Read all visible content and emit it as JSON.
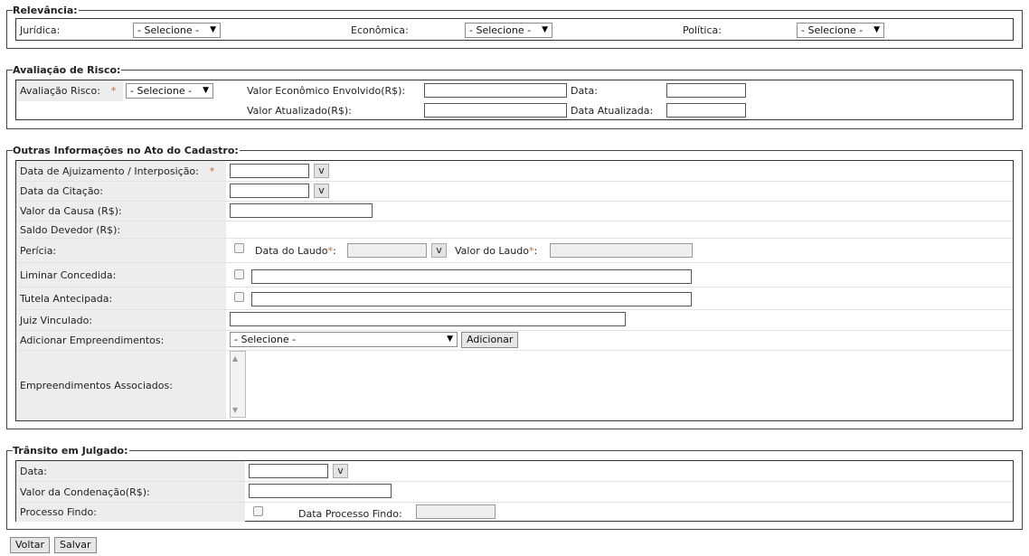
{
  "relevancia": {
    "legend": "Relevância:",
    "juridica_label": "Jurídica:",
    "juridica_value": "- Selecione -",
    "economica_label": "Econômica:",
    "economica_value": "- Selecione -",
    "politica_label": "Política:",
    "politica_value": "- Selecione -"
  },
  "avaliacao": {
    "legend": "Avaliação de Risco:",
    "risco_label": "Avaliação Risco:",
    "risco_value": "- Selecione -",
    "valor_economico_label": "Valor Econômico Envolvido(R$):",
    "data_label": "Data:",
    "valor_atualizado_label": "Valor Atualizado(R$):",
    "data_atualizada_label": "Data Atualizada:"
  },
  "outras": {
    "legend": "Outras Informações no Ato do Cadastro:",
    "ajuizamento_label": "Data de Ajuizamento / Interposição:",
    "citacao_label": "Data da Citação:",
    "valor_causa_label": "Valor da Causa (R$):",
    "saldo_devedor_label": "Saldo Devedor (R$):",
    "pericia_label": "Perícia:",
    "data_laudo_label": "Data do Laudo",
    "valor_laudo_label": "Valor do Laudo",
    "liminar_label": "Liminar Concedida:",
    "tutela_label": "Tutela Antecipada:",
    "juiz_label": "Juiz Vinculado:",
    "adicionar_label": "Adicionar Empreendimentos:",
    "adicionar_value": "- Selecione -",
    "adicionar_button": "Adicionar",
    "associados_label": "Empreendimentos Associados:"
  },
  "transito": {
    "legend": "Trânsito em Julgado:",
    "data_label": "Data:",
    "valor_condenacao_label": "Valor da Condenação(R$):",
    "processo_findo_label": "Processo Findo:",
    "data_processo_findo_label": "Data Processo Findo:"
  },
  "common": {
    "required_mark": "*",
    "colon": ":",
    "calendar_button": "v",
    "dropdown_arrow": "▼",
    "scroll_up": "▲",
    "scroll_down": "▼"
  },
  "actions": {
    "voltar": "Voltar",
    "salvar": "Salvar"
  }
}
